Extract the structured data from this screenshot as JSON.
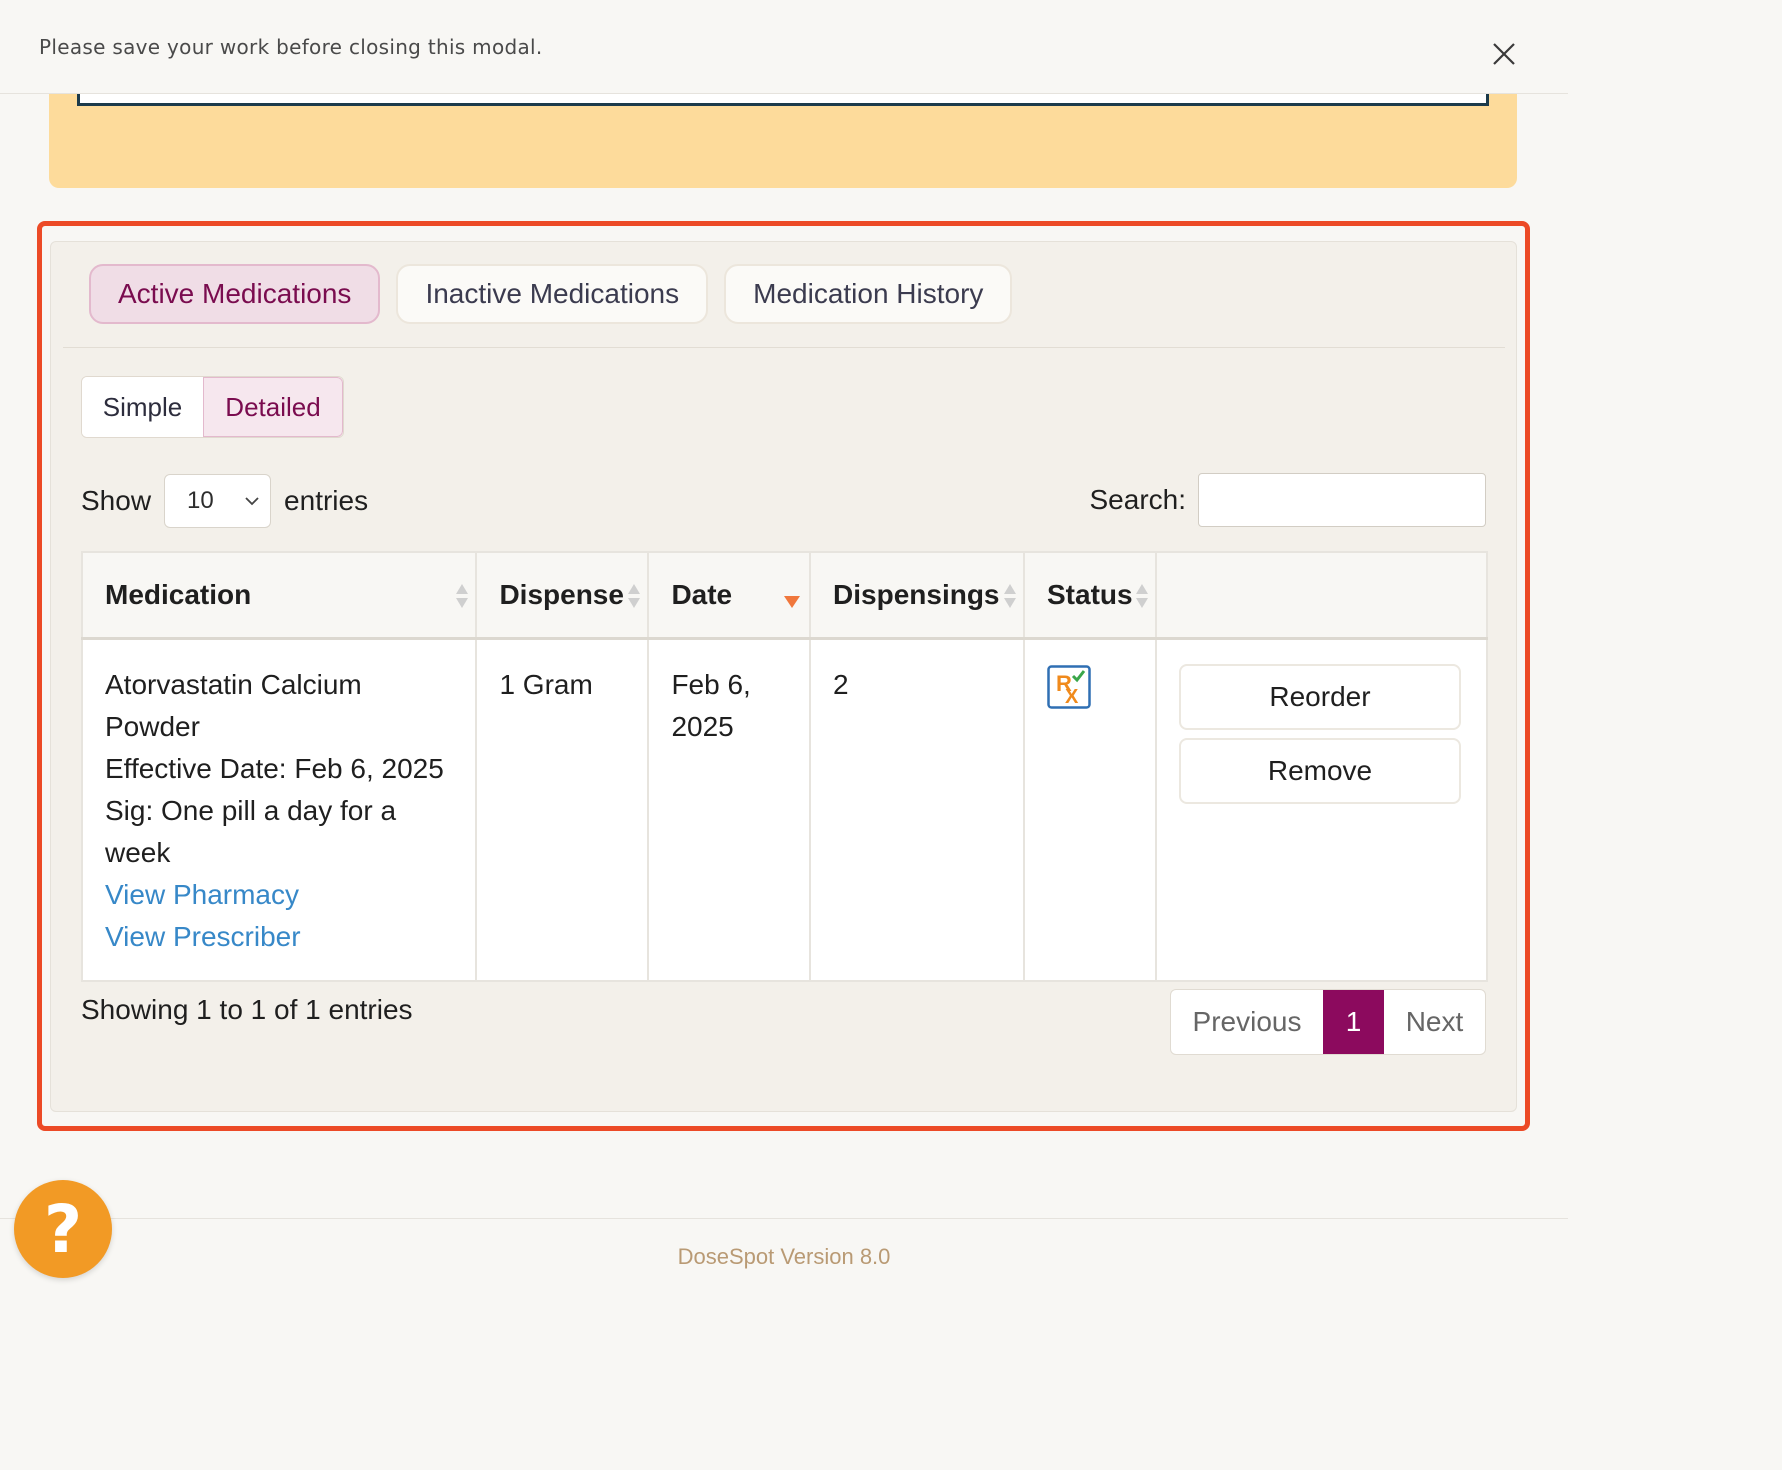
{
  "notice": {
    "text": "Please save your work before closing this modal."
  },
  "tabs": [
    {
      "label": "Active Medications",
      "active": true
    },
    {
      "label": "Inactive Medications",
      "active": false
    },
    {
      "label": "Medication History",
      "active": false
    }
  ],
  "view_toggle": {
    "simple": "Simple",
    "detailed": "Detailed",
    "selected": "Detailed"
  },
  "length_control": {
    "show_label": "Show",
    "selected": "10",
    "entries_label": "entries"
  },
  "search": {
    "label": "Search:",
    "value": "",
    "placeholder": ""
  },
  "table": {
    "columns": [
      "Medication",
      "Dispense",
      "Date",
      "Dispensings",
      "Status",
      ""
    ],
    "sorted_column": "Date",
    "sort_direction": "descending",
    "rows": [
      {
        "medication_name": "Atorvastatin Calcium",
        "medication_form": "Powder",
        "effective_date": "Effective Date: Feb 6, 2025",
        "sig_line1": "Sig: One pill a day for a",
        "sig_line2": "week",
        "view_pharmacy": "View Pharmacy",
        "view_prescriber": "View Prescriber",
        "dispense": "1 Gram",
        "date_line1": "Feb 6,",
        "date_line2": "2025",
        "dispensings": "2",
        "status_icon": "rx-icon",
        "actions": {
          "reorder": "Reorder",
          "remove": "Remove"
        }
      }
    ]
  },
  "info": {
    "text": "Showing 1 to 1 of 1 entries"
  },
  "pagination": {
    "previous": "Previous",
    "current": "1",
    "next": "Next"
  },
  "footer": {
    "version": "DoseSpot Version 8.0"
  },
  "help": {
    "glyph": "?",
    "icon": "help-icon"
  },
  "colors": {
    "accent": "#8c0a5e",
    "highlight_border": "#ec4a26",
    "warning_panel": "#fddb9b",
    "link": "#3788c8",
    "help_button": "#f29a25"
  }
}
